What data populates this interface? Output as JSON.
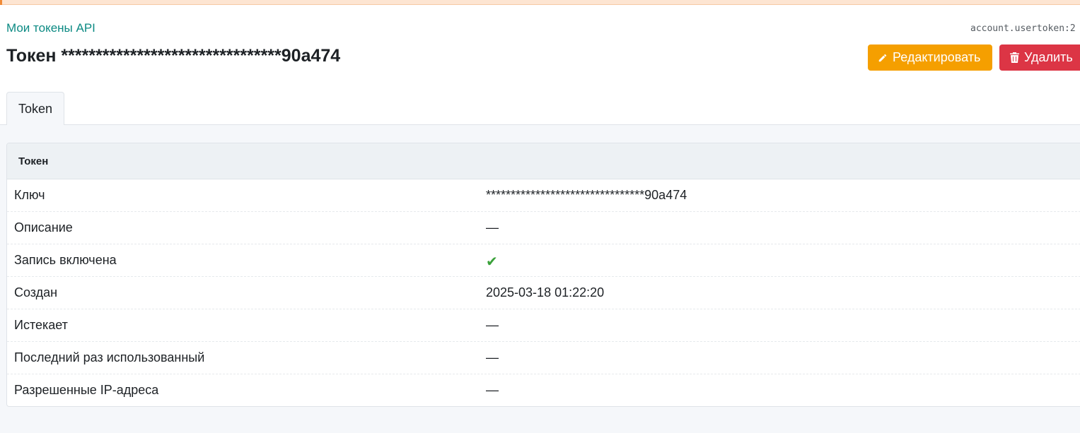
{
  "breadcrumb": "Мои токены API",
  "object_id": "account.usertoken:2",
  "title": "Токен ********************************90a474",
  "actions": {
    "edit_label": "Редактировать",
    "delete_label": "Удалить"
  },
  "tabs": [
    {
      "label": "Token",
      "active": true
    }
  ],
  "card": {
    "title": "Токен",
    "rows": [
      {
        "label": "Ключ",
        "value": "********************************90a474"
      },
      {
        "label": "Описание",
        "value": "—"
      },
      {
        "label": "Запись включена",
        "value": "✔"
      },
      {
        "label": "Создан",
        "value": "2025-03-18 01:22:20"
      },
      {
        "label": "Истекает",
        "value": "—"
      },
      {
        "label": "Последний раз использованный",
        "value": "—"
      },
      {
        "label": "Разрешенные IP-адреса",
        "value": "—"
      }
    ]
  },
  "colors": {
    "link": "#0c8a83",
    "edit": "#f59f00",
    "delete": "#dc3545",
    "check": "#3aa13a",
    "alert_strip": "#fde5d2"
  },
  "icons": {
    "edit": "pencil-icon",
    "delete": "trash-icon",
    "enabled": "check-icon"
  }
}
